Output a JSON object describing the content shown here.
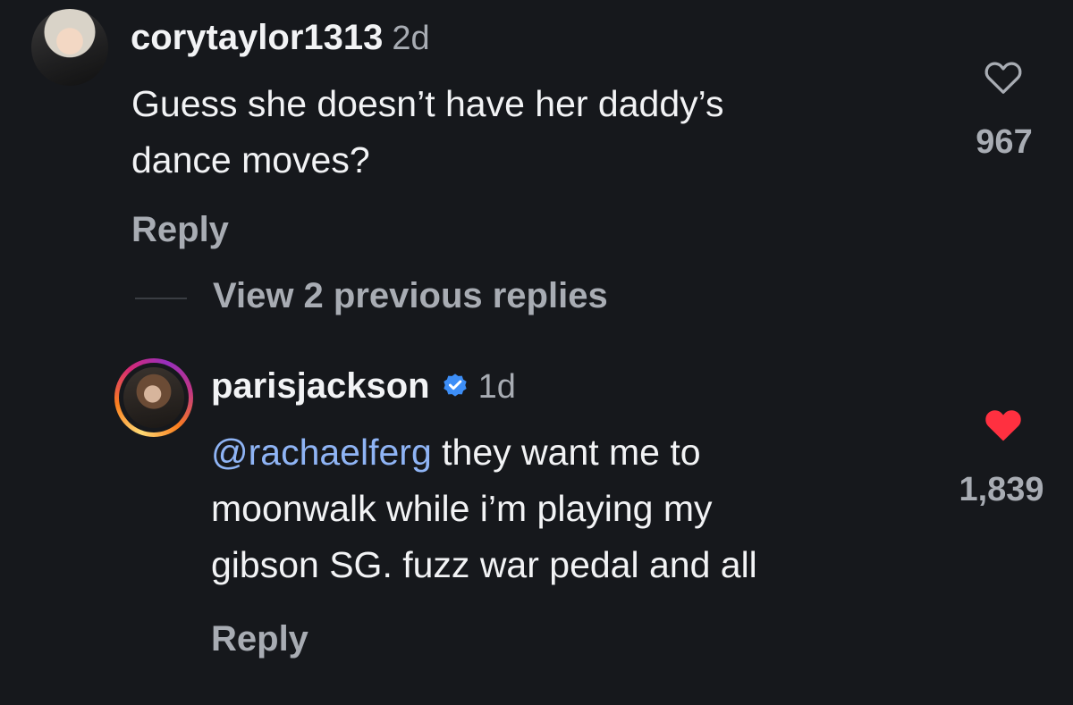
{
  "comment1": {
    "username": "corytaylor1313",
    "time": "2d",
    "text_line1": "Guess she doesn’t have her daddy’s",
    "text_line2": "dance moves?",
    "reply_label": "Reply",
    "likes": "967",
    "liked": false,
    "avatar_icon": "profile-photo"
  },
  "view_replies": {
    "label": "View 2 previous replies"
  },
  "comment2": {
    "username": "parisjackson",
    "verified": true,
    "time": "1d",
    "mention": "@rachaelferg",
    "text_line1_rest": " they want me to",
    "text_line2": "moonwalk while i’m playing my",
    "text_line3": "gibson SG. fuzz war pedal and all",
    "reply_label": "Reply",
    "likes": "1,839",
    "liked": true,
    "avatar_icon": "profile-photo-story-ring"
  },
  "colors": {
    "background": "#16181c",
    "primary_text": "#f2f3f5",
    "secondary_text": "#a8acb3",
    "mention": "#8fb4f5",
    "like_active": "#ff3040",
    "verified_badge": "#3d8ef7"
  }
}
